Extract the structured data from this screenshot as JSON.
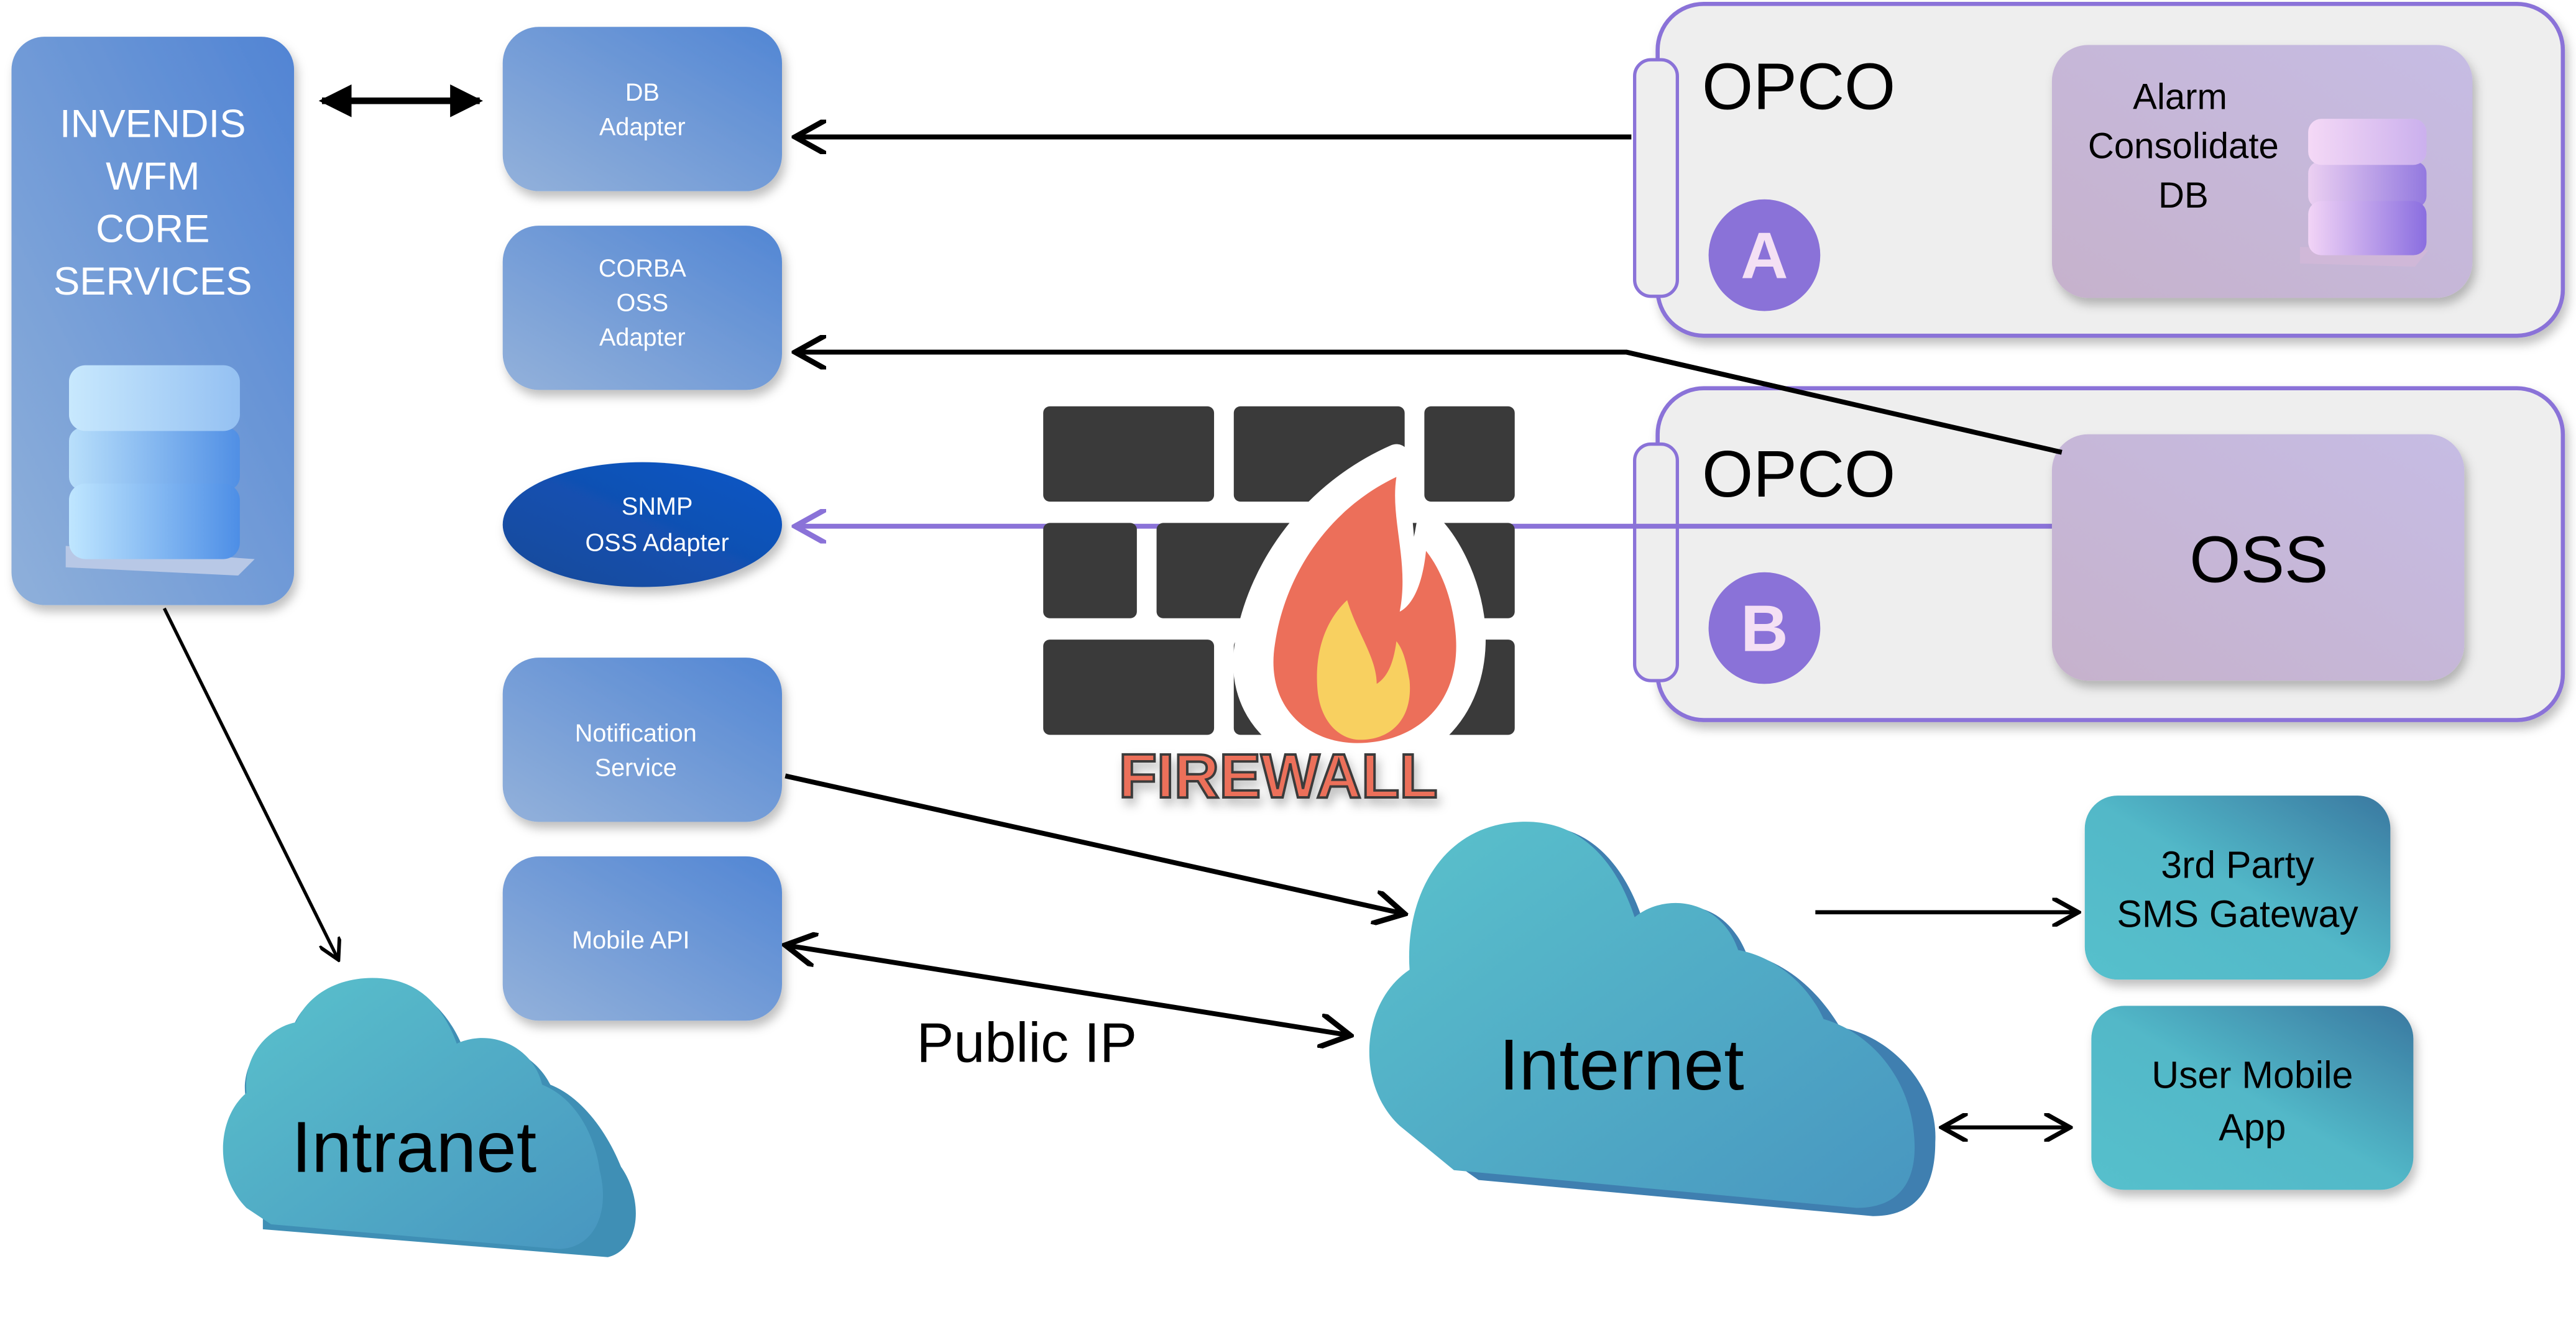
{
  "core": {
    "lines": [
      "INVENDIS",
      "WFM",
      "CORE",
      "SERVICES"
    ]
  },
  "adapters": {
    "db": [
      "DB",
      "Adapter"
    ],
    "corba": [
      "CORBA",
      "OSS",
      "Adapter"
    ],
    "snmp": [
      "SNMP",
      "OSS Adapter"
    ],
    "notification": [
      "Notification",
      "Service"
    ],
    "mobile_api": [
      "Mobile API"
    ]
  },
  "firewall": {
    "label": "FIREWALL"
  },
  "opco_a": {
    "title": "OPCO",
    "badge": "A",
    "db_lines": [
      "Alarm",
      "Consolidate",
      "DB"
    ]
  },
  "opco_b": {
    "title": "OPCO",
    "badge": "B",
    "oss": "OSS"
  },
  "clouds": {
    "intranet": "Intranet",
    "internet": "Internet"
  },
  "public_ip": "Public IP",
  "external": {
    "sms": [
      "3rd Party",
      "SMS Gateway"
    ],
    "mobile_app": [
      "User Mobile",
      "App"
    ]
  },
  "colors": {
    "adapter_blue": "#5a8bd4",
    "snmp_blue": "#1450b0",
    "opco_purple": "#8a72d8",
    "cloud_teal": "#55bfcc",
    "firewall_red": "#ec6f5a",
    "firewall_yellow": "#f8d060",
    "brick": "#3a3a3a"
  }
}
